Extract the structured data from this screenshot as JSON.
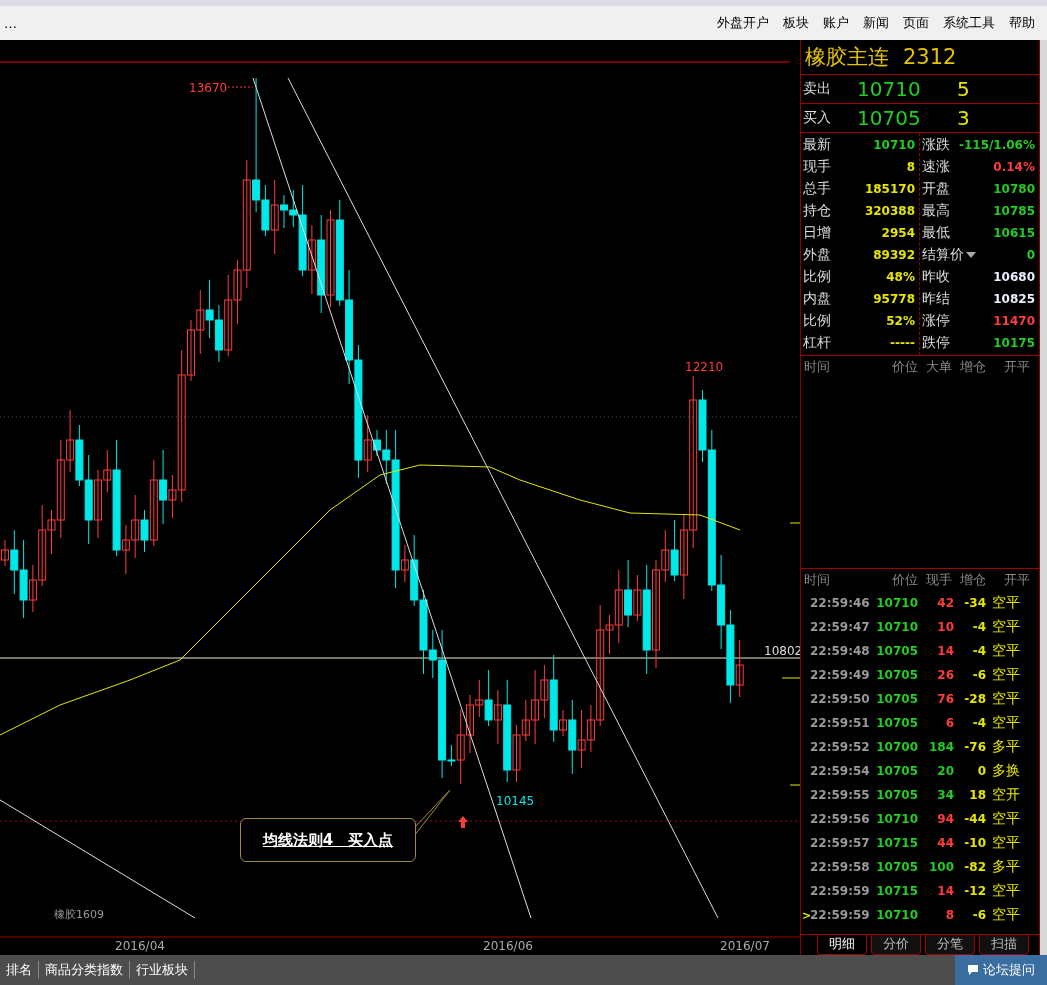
{
  "menu": {
    "overflow": "…",
    "items": [
      "外盘开户",
      "板块",
      "账户",
      "新闻",
      "页面",
      "系统工具",
      "帮助"
    ]
  },
  "chart": {
    "high_label": "13670",
    "peak_label": "12210",
    "low_label": "10145",
    "price_line_label": "10802",
    "contract_label": "橡胶1609",
    "dates": [
      "2016/04",
      "2016/06",
      "2016/07"
    ],
    "callout": "均线法则4　买入点"
  },
  "quote": {
    "name": "橡胶主连",
    "code": "2312",
    "order_book": [
      {
        "label": "卖出",
        "price": "10710",
        "volume": "5"
      },
      {
        "label": "买入",
        "price": "10705",
        "volume": "3"
      }
    ],
    "stats_left": [
      {
        "label": "最新",
        "value": "10710",
        "color": "#22cc22"
      },
      {
        "label": "现手",
        "value": "8",
        "color": "#e6e600"
      },
      {
        "label": "总手",
        "value": "185170",
        "color": "#e6e600"
      },
      {
        "label": "持仓",
        "value": "320388",
        "color": "#e6e600"
      },
      {
        "label": "日增",
        "value": "2954",
        "color": "#e6e600"
      },
      {
        "label": "外盘",
        "value": "89392",
        "color": "#e6e600"
      },
      {
        "label": "比例",
        "value": "48%",
        "color": "#e6e600"
      },
      {
        "label": "内盘",
        "value": "95778",
        "color": "#e6e600"
      },
      {
        "label": "比例",
        "value": "52%",
        "color": "#e6e600"
      },
      {
        "label": "杠杆",
        "value": "-----",
        "color": "#e6e600"
      }
    ],
    "stats_right": [
      {
        "label": "涨跌",
        "value": "-115/1.06%",
        "color": "#22cc22",
        "kind": "plain"
      },
      {
        "label": "速涨",
        "value": "0.14%",
        "color": "#ff3c3c",
        "kind": "plain"
      },
      {
        "label": "开盘",
        "value": "10780",
        "color": "#22cc22",
        "kind": "plain"
      },
      {
        "label": "最高",
        "value": "10785",
        "color": "#22cc22",
        "kind": "plain"
      },
      {
        "label": "最低",
        "value": "10615",
        "color": "#22cc22",
        "kind": "plain"
      },
      {
        "label": "结算价",
        "value": "0",
        "color": "#22cc22",
        "kind": "dropdown"
      },
      {
        "label": "昨收",
        "value": "10680",
        "color": "#e8f0ff",
        "kind": "plain"
      },
      {
        "label": "昨结",
        "value": "10825",
        "color": "#e8f0ff",
        "kind": "plain"
      },
      {
        "label": "涨停",
        "value": "11470",
        "color": "#ff3c3c",
        "kind": "plain"
      },
      {
        "label": "跌停",
        "value": "10175",
        "color": "#22cc22",
        "kind": "plain"
      }
    ],
    "big_orders": {
      "columns": [
        "时间",
        "价位",
        "大单",
        "增仓",
        "开平"
      ]
    },
    "ticks": {
      "columns": [
        "时间",
        "价位",
        "现手",
        "增仓",
        "开平"
      ],
      "rows": [
        {
          "time": "22:59:46",
          "price": "10710",
          "volume": "42",
          "change": "-34",
          "type": "空平",
          "color": "#ff3c3c"
        },
        {
          "time": "22:59:47",
          "price": "10710",
          "volume": "10",
          "change": "-4",
          "type": "空平",
          "color": "#ff3c3c"
        },
        {
          "time": "22:59:48",
          "price": "10705",
          "volume": "14",
          "change": "-4",
          "type": "空平",
          "color": "#ff3c3c"
        },
        {
          "time": "22:59:49",
          "price": "10705",
          "volume": "26",
          "change": "-6",
          "type": "空平",
          "color": "#ff3c3c"
        },
        {
          "time": "22:59:50",
          "price": "10705",
          "volume": "76",
          "change": "-28",
          "type": "空平",
          "color": "#ff3c3c"
        },
        {
          "time": "22:59:51",
          "price": "10705",
          "volume": "6",
          "change": "-4",
          "type": "空平",
          "color": "#ff3c3c"
        },
        {
          "time": "22:59:52",
          "price": "10700",
          "volume": "184",
          "change": "-76",
          "type": "多平",
          "color": "#22cc22"
        },
        {
          "time": "22:59:54",
          "price": "10705",
          "volume": "20",
          "change": "0",
          "type": "多换",
          "color": "#22cc22"
        },
        {
          "time": "22:59:55",
          "price": "10705",
          "volume": "34",
          "change": "18",
          "type": "空开",
          "color": "#22cc22"
        },
        {
          "time": "22:59:56",
          "price": "10710",
          "volume": "94",
          "change": "-44",
          "type": "空平",
          "color": "#ff3c3c"
        },
        {
          "time": "22:59:57",
          "price": "10715",
          "volume": "44",
          "change": "-10",
          "type": "空平",
          "color": "#ff3c3c"
        },
        {
          "time": "22:59:58",
          "price": "10705",
          "volume": "100",
          "change": "-82",
          "type": "多平",
          "color": "#22cc22"
        },
        {
          "time": "22:59:59",
          "price": "10715",
          "volume": "14",
          "change": "-12",
          "type": "空平",
          "color": "#ff3c3c"
        },
        {
          "time": "22:59:59",
          "price": "10710",
          "volume": "8",
          "change": "-6",
          "type": "空平",
          "color": "#ff3c3c",
          "marker": ">"
        }
      ]
    },
    "tabs": [
      {
        "label": "明细",
        "selected": true
      },
      {
        "label": "分价",
        "selected": false
      },
      {
        "label": "分笔",
        "selected": false
      },
      {
        "label": "扫描",
        "selected": false
      }
    ]
  },
  "status_bar": {
    "items": [
      "排名",
      "商品分类指数",
      "行业板块"
    ],
    "button": "论坛提问"
  }
}
